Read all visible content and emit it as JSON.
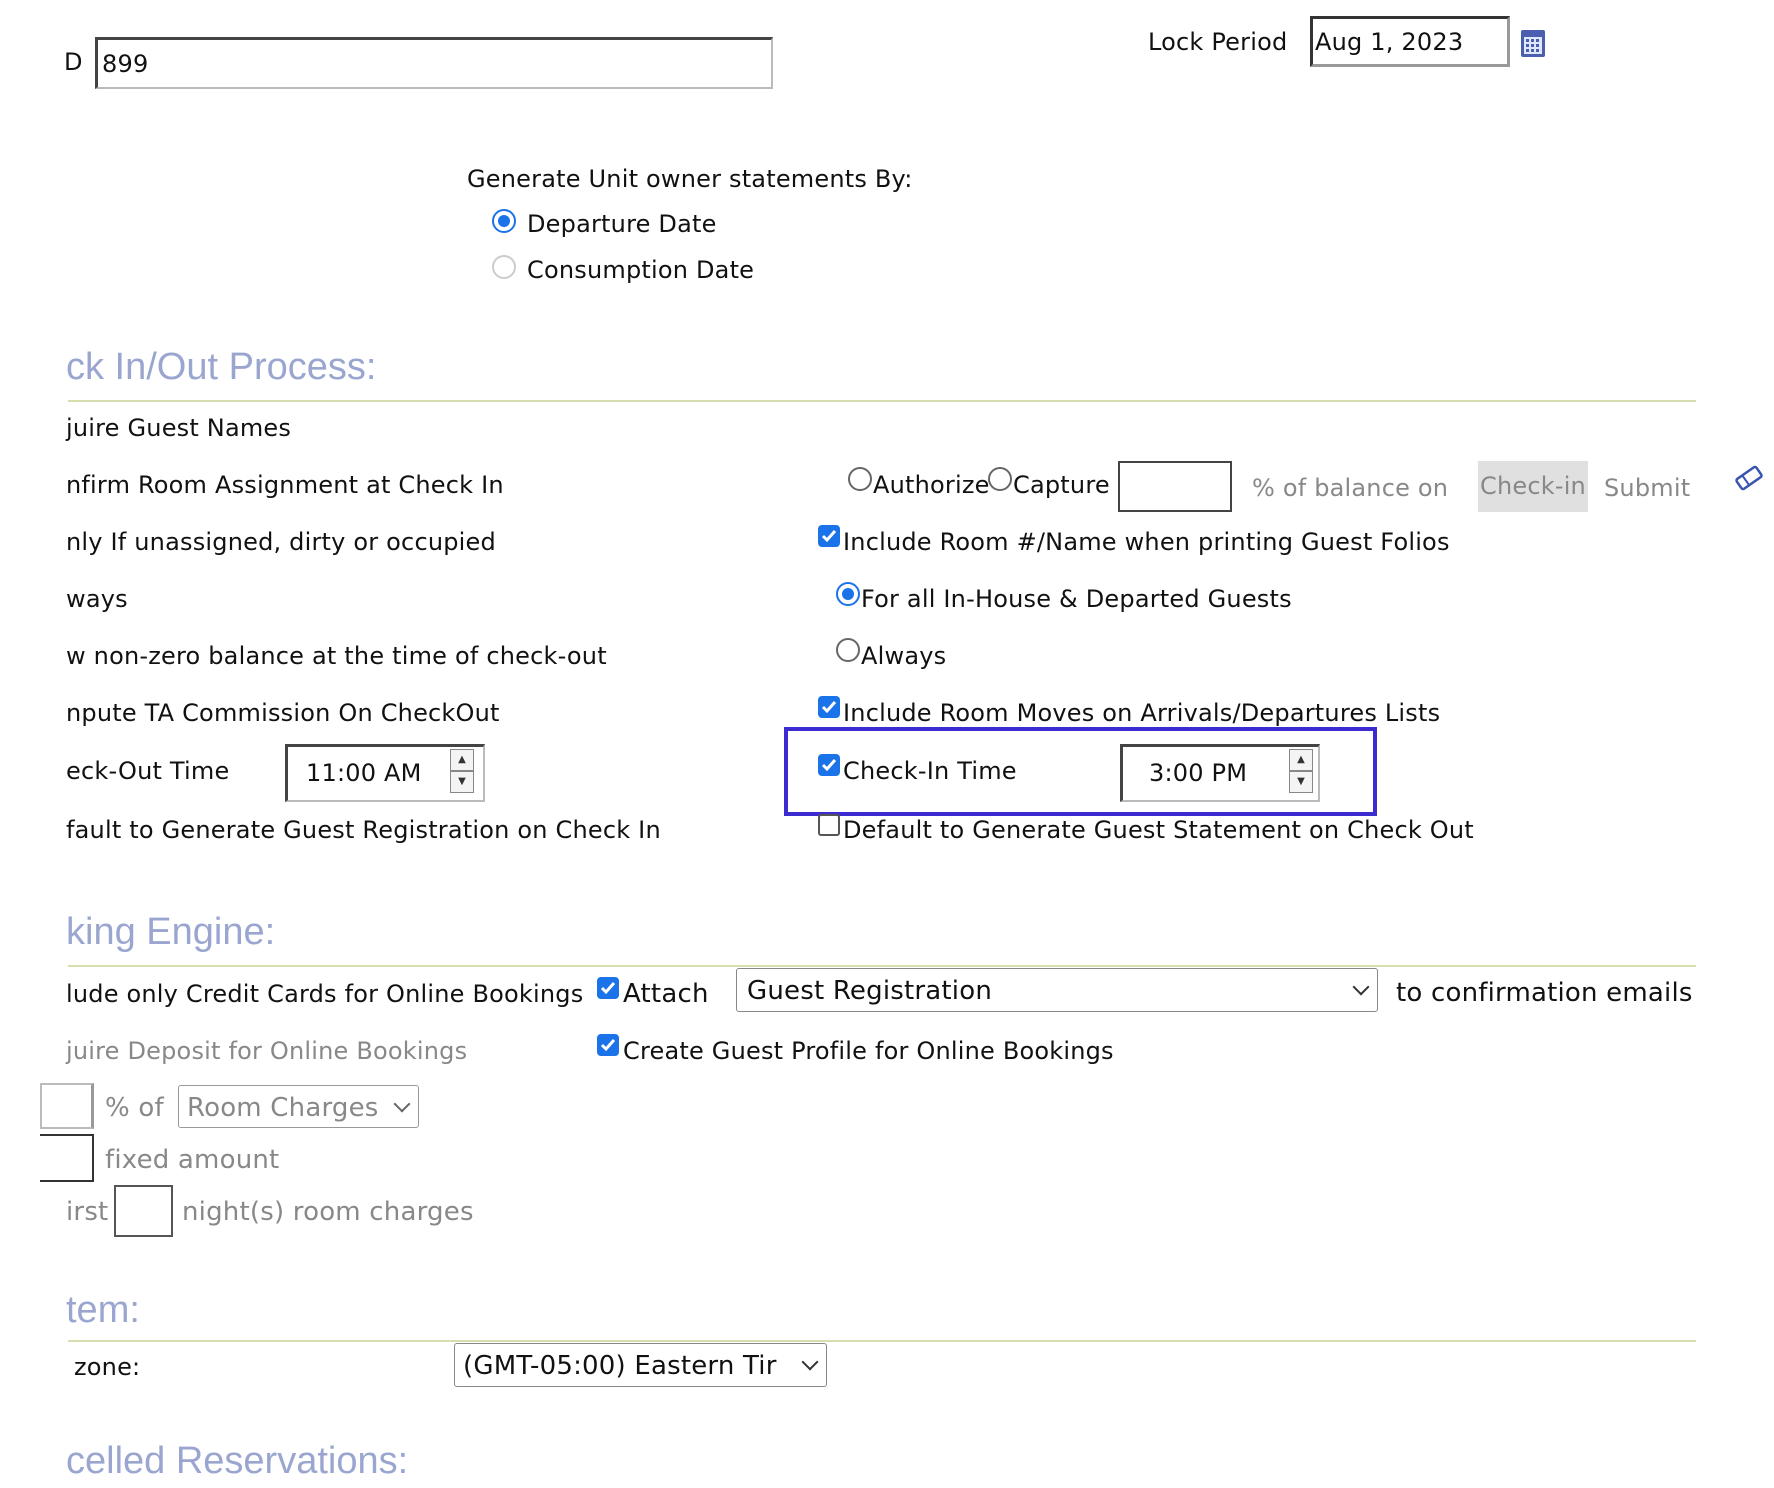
{
  "top": {
    "id_label": "D",
    "id_value": "899",
    "lock_period_label": "Lock Period",
    "lock_period_value": "Aug 1, 2023"
  },
  "statements": {
    "heading": "Generate Unit owner statements By:",
    "options": [
      {
        "label": "Departure Date",
        "selected": true
      },
      {
        "label": "Consumption Date",
        "selected": false
      }
    ]
  },
  "checkinout": {
    "title": "ck In/Out Process:",
    "left": [
      "juire Guest Names",
      "nfirm Room Assignment at Check In",
      "nly If unassigned, dirty or occupied",
      "ways",
      "w non-zero balance at the time of check-out",
      "npute TA Commission On CheckOut",
      "eck-Out Time",
      "fault to Generate Guest Registration on Check In"
    ],
    "checkout_time": "11:00 AM",
    "authorize_label": "Authorize",
    "capture_label": "Capture",
    "balance_text": "% of balance on",
    "checkin_highlight": "Check-in",
    "submit_text": "Submit",
    "include_room_label": "Include Room #/Name when printing Guest Folios",
    "for_all_label": "For all In-House & Departed Guests",
    "always_label": "Always",
    "include_moves_label": "Include Room Moves on Arrivals/Departures Lists",
    "checkin_time_label": "Check-In Time",
    "checkin_time_value": "3:00 PM",
    "default_statement_label": "Default to Generate Guest Statement on Check Out"
  },
  "booking": {
    "title": "king Engine:",
    "include_cc_label": "lude only Credit Cards for Online Bookings",
    "attach_label": "Attach",
    "attach_select": "Guest Registration",
    "to_confirmation": "to confirmation emails",
    "require_deposit_label": "juire Deposit for Online Bookings",
    "create_profile_label": "Create Guest Profile for Online Bookings",
    "percent_of": "% of",
    "room_charges_select": "Room Charges",
    "fixed_amount": "fixed amount",
    "first_label": "irst",
    "nights_label": "night(s) room charges"
  },
  "system": {
    "title": "tem:",
    "zone_label": "zone:",
    "zone_select": "(GMT-05:00) Eastern Tir"
  },
  "cancelled": {
    "title": "celled Reservations:"
  },
  "colors": {
    "accent": "#1a73e8",
    "heading": "#9aa6cf",
    "rule": "#d6deb0",
    "highlight_box": "#3b2bd1"
  }
}
